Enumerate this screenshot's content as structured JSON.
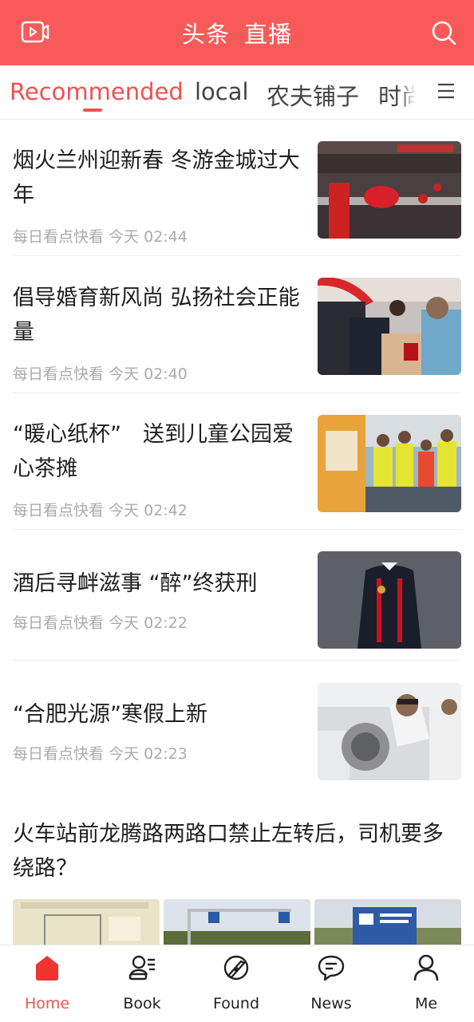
{
  "colors": {
    "brand": "#f85a5a",
    "accent": "#f0504f",
    "meta": "#aaaaaa"
  },
  "header": {
    "left_icon": "tv-icon",
    "titles": [
      "头条",
      "直播"
    ],
    "right_icon": "search-icon"
  },
  "tabs": {
    "items": [
      {
        "label": "Recommended",
        "active": true
      },
      {
        "label": "local"
      },
      {
        "label": "农夫铺子"
      },
      {
        "label": "时尚"
      }
    ],
    "menu_icon": "hamburger-icon"
  },
  "articles": [
    {
      "title": "烟火兰州迎新春 冬游金城过大年",
      "source": "每日看点快看",
      "time": "今天 02:44",
      "image": "lion-dance-crowd"
    },
    {
      "title": "倡导婚育新风尚 弘扬社会正能量",
      "source": "每日看点快看",
      "time": "今天 02:40",
      "image": "marriage-registration"
    },
    {
      "title": "“暖心纸杯”　送到儿童公园爱心茶摊",
      "source": "每日看点快看",
      "time": "今天 02:42",
      "image": "volunteers-tea-stall"
    },
    {
      "title": "酒后寻衅滋事 “醉”终获刑",
      "source": "每日看点快看",
      "time": "今天 02:22",
      "image": "judge-robe"
    },
    {
      "title": "“合肥光源”寒假上新",
      "source": "每日看点快看",
      "time": "今天 02:23",
      "image": "lab-researcher"
    }
  ],
  "multi_article": {
    "title": "火车站前龙腾路两路口禁止左转后，司机要多绕路？",
    "images": [
      "traffic-map",
      "traffic-signals",
      "road-sign"
    ]
  },
  "bottom_nav": [
    {
      "label": "Home",
      "icon": "home-icon",
      "active": true
    },
    {
      "label": "Book",
      "icon": "book-icon"
    },
    {
      "label": "Found",
      "icon": "compass-icon"
    },
    {
      "label": "News",
      "icon": "chat-icon"
    },
    {
      "label": "Me",
      "icon": "person-icon"
    }
  ]
}
